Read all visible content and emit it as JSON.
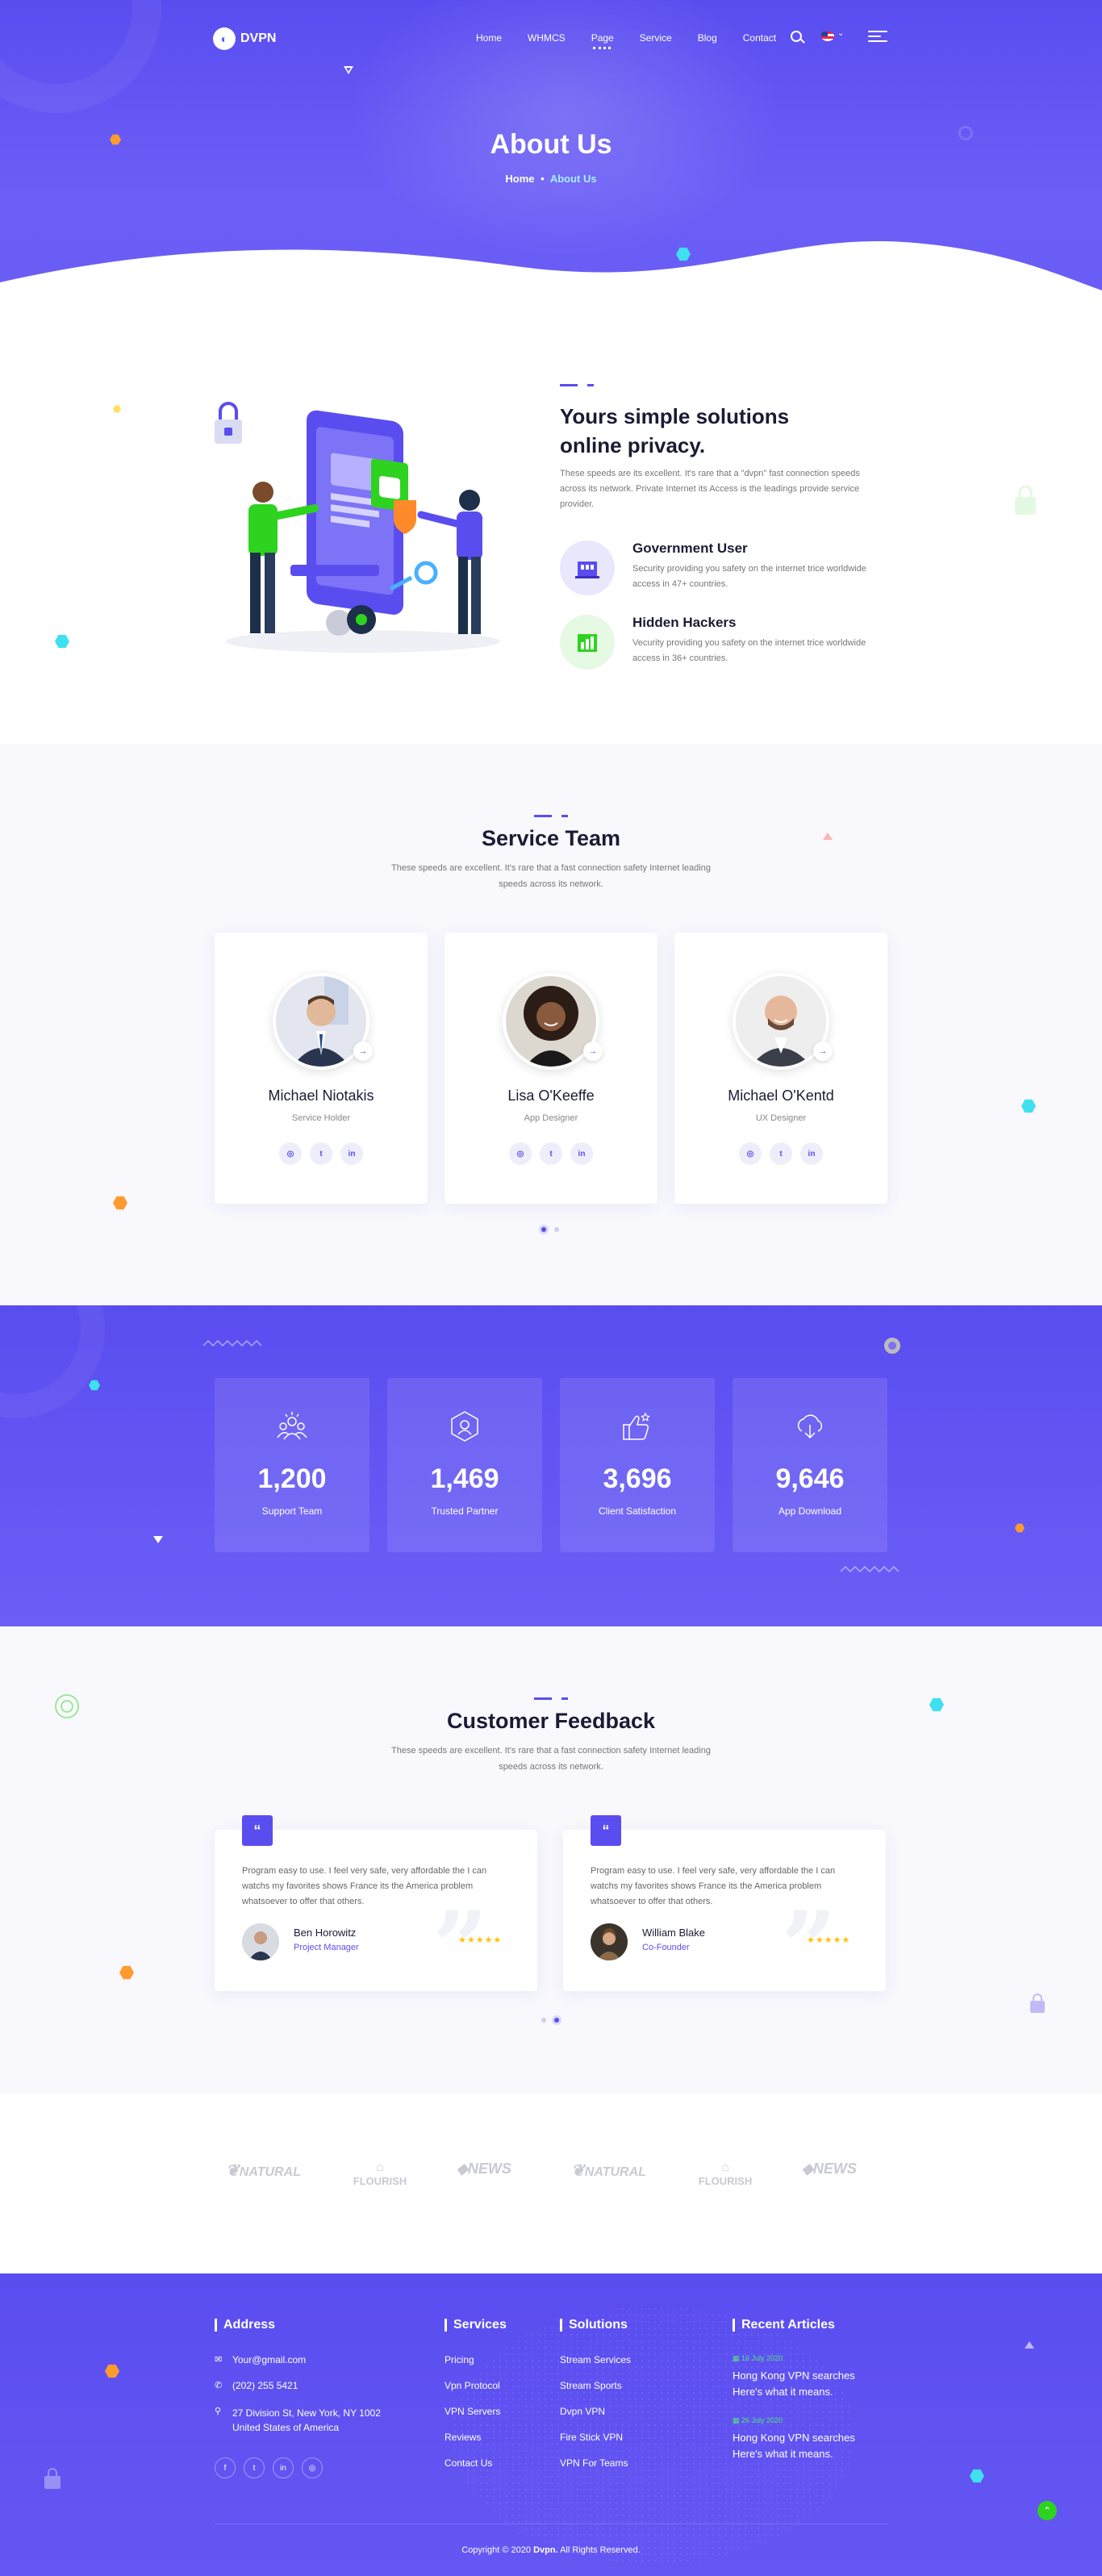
{
  "nav": {
    "brand": "DVPN",
    "items": [
      "Home",
      "WHMCS",
      "Page",
      "Service",
      "Blog",
      "Contact"
    ],
    "active": "Page"
  },
  "hero": {
    "title": "About Us",
    "breadcrumb_home": "Home",
    "breadcrumb_sep": "•",
    "breadcrumb_current": "About Us"
  },
  "about": {
    "title": "Yours simple solutions online privacy.",
    "lead": "These speeds are its excellent. It's rare that a \"dvpn\" fast connection speeds across its network. Private Internet its Access is the leadings provide service provider.",
    "features": [
      {
        "title": "Government User",
        "text": "Security providing you safety on the internet trice worldwide access in 47+ countries."
      },
      {
        "title": "Hidden Hackers",
        "text": "Vecurity providing you safety on the internet trice worldwide access in 36+ countries."
      }
    ]
  },
  "team": {
    "title": "Service Team",
    "desc": "These speeds are excellent. It's rare that a fast connection safety Internet leading speeds across its network.",
    "members": [
      {
        "name": "Michael Niotakis",
        "role": "Service Holder"
      },
      {
        "name": "Lisa O'Keeffe",
        "role": "App Designer"
      },
      {
        "name": "Michael O'Kentd",
        "role": "UX Designer"
      }
    ]
  },
  "stats": [
    {
      "value": "1,200",
      "label": "Support Team",
      "icon": "team-icon"
    },
    {
      "value": "1,469",
      "label": "Trusted Partner",
      "icon": "network-icon"
    },
    {
      "value": "3,696",
      "label": "Client Satisfaction",
      "icon": "thumbs-up-icon"
    },
    {
      "value": "9,646",
      "label": "App Download",
      "icon": "cloud-download-icon"
    }
  ],
  "feedback": {
    "title": "Customer Feedback",
    "desc": "These speeds are excellent. It's rare that a fast connection safety Internet leading speeds across its network.",
    "items": [
      {
        "text": "Program easy to use. I feel very safe, very affordable the I can watchs my favorites shows France its the America problem whatsoever to offer that others.",
        "name": "Ben Horowitz",
        "role": "Project Manager",
        "stars": "★★★★★"
      },
      {
        "text": "Program easy to use. I feel very safe, very affordable the I can watchs my favorites shows France its the America problem whatsoever to offer that others.",
        "name": "William Blake",
        "role": "Co-Founder",
        "stars": "★★★★★"
      }
    ]
  },
  "partners": [
    "NATURAL",
    "FLOURISH",
    "NEWS",
    "NATURAL",
    "FLOURISH",
    "NEWS"
  ],
  "footer": {
    "address": {
      "title": "Address",
      "email": "Your@gmail.com",
      "phone": "(202) 255 5421",
      "street": "27 Division St, New York, NY 1002",
      "country": "United States of America"
    },
    "services": {
      "title": "Services",
      "items": [
        "Pricing",
        "Vpn Protocol",
        "VPN Servers",
        "Reviews",
        "Contact Us"
      ]
    },
    "solutions": {
      "title": "Solutions",
      "items": [
        "Stream Services",
        "Stream Sports",
        "Dvpn VPN",
        "Fire Stick VPN",
        "VPN For Teams"
      ]
    },
    "articles": {
      "title": "Recent Articles",
      "items": [
        {
          "date": "16 July 2020",
          "title": "Hong Kong VPN searches Here's what it means."
        },
        {
          "date": "26 July 2020",
          "title": "Hong Kong VPN searches Here's what it means."
        }
      ]
    },
    "copyright_prefix": "Copyright © 2020",
    "copyright_brand": "Dvpn.",
    "copyright_suffix": "All Rights Reserved."
  },
  "colors": {
    "primary": "#5a4df0",
    "accent_cyan": "#3fe0f0",
    "accent_orange": "#ff9a2e",
    "success": "#2ed31f"
  }
}
